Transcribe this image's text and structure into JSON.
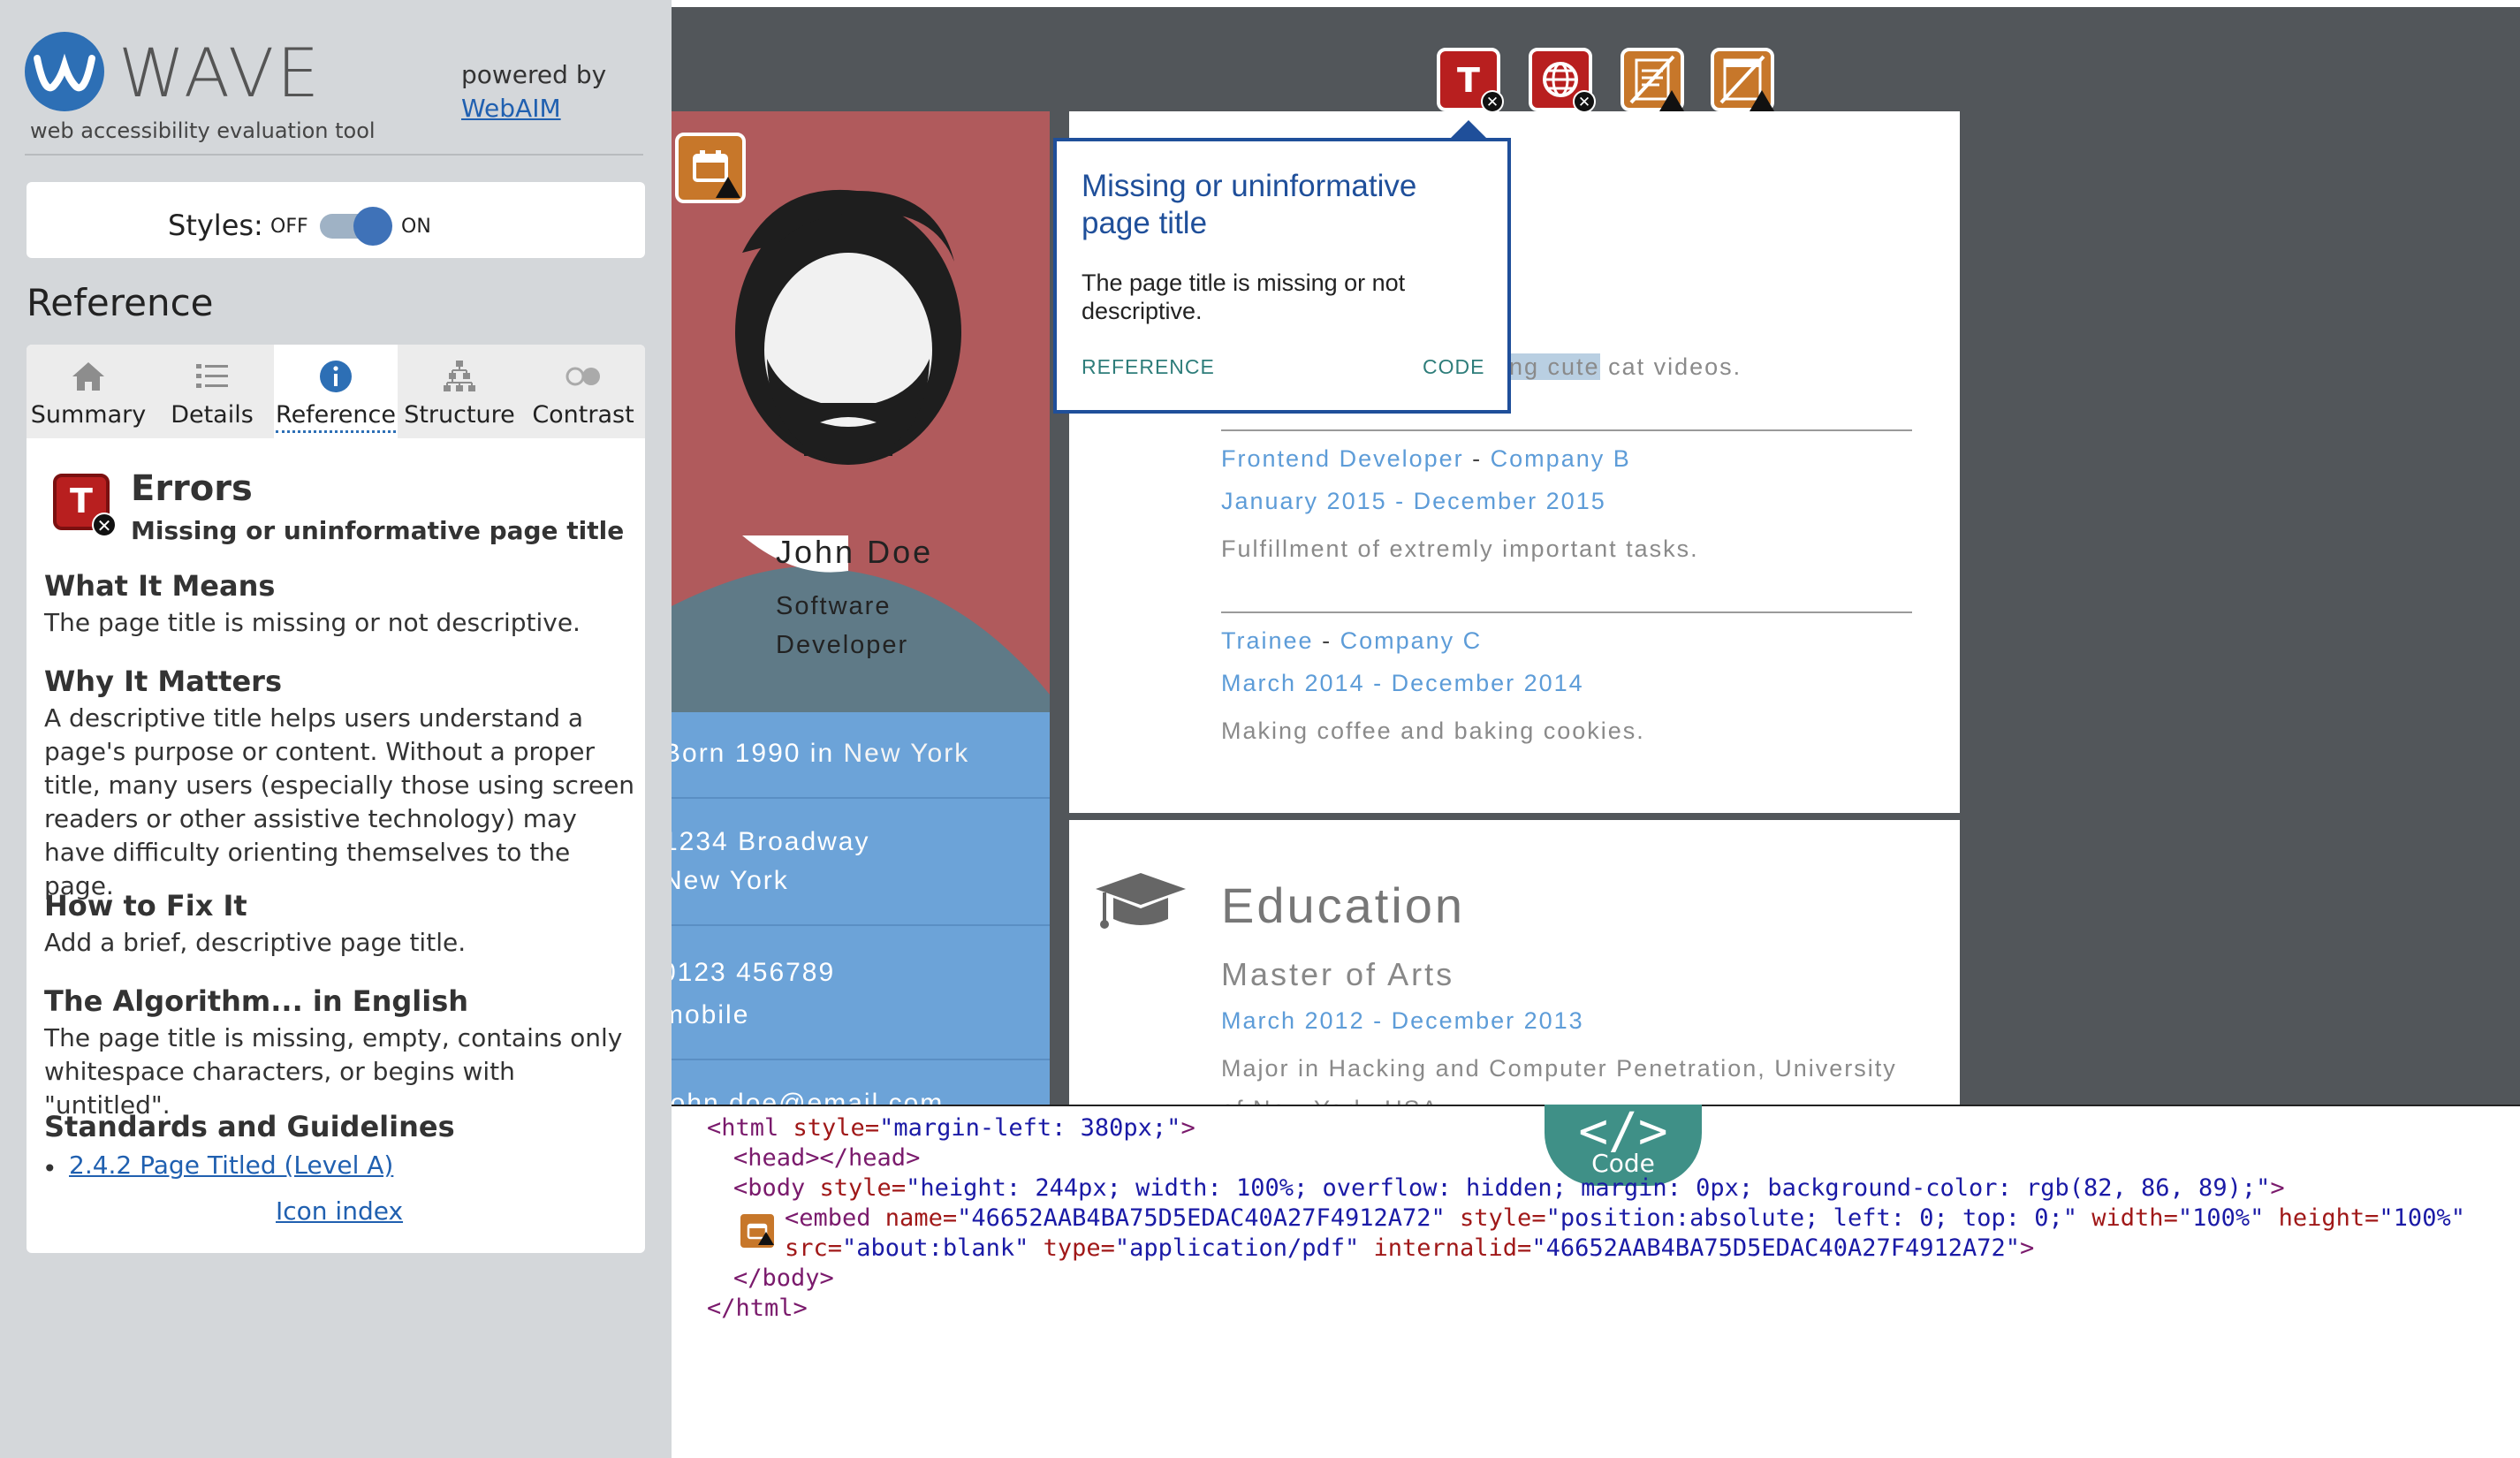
{
  "sidebar": {
    "logo_text": "WAVE",
    "logo_sub": "web accessibility evaluation tool",
    "powered_by": "powered by",
    "webaim_link": "WebAIM",
    "styles_label": "Styles:",
    "toggle_off": "OFF",
    "toggle_on": "ON",
    "reference_heading": "Reference",
    "tabs": [
      {
        "label": "Summary",
        "icon": "home-icon"
      },
      {
        "label": "Details",
        "icon": "list-icon"
      },
      {
        "label": "Reference",
        "icon": "info-icon"
      },
      {
        "label": "Structure",
        "icon": "structure-icon"
      },
      {
        "label": "Contrast",
        "icon": "contrast-icon"
      }
    ],
    "active_tab": "Reference",
    "error": {
      "category": "Errors",
      "name": "Missing or uninformative page title",
      "icon_letter": "T"
    },
    "sections": {
      "what_h": "What It Means",
      "what_p": "The page title is missing or not descriptive.",
      "why_h": "Why It Matters",
      "why_p": "A descriptive title helps users understand a page's purpose or content. Without a proper title, many users (especially those using screen readers or other assistive technology) may have difficulty orienting themselves to the page.",
      "fix_h": "How to Fix It",
      "fix_p": "Add a brief, descriptive page title.",
      "algo_h": "The Algorithm... in English",
      "algo_p": "The page title is missing, empty, contains only whitespace characters, or begins with \"untitled\".",
      "std_h": "Standards and Guidelines",
      "std_link": "2.4.2 Page Titled (Level A)",
      "icon_index": "Icon index"
    }
  },
  "preview": {
    "name": "John Doe",
    "role_line1": "Software",
    "role_line2": "Developer",
    "born_pre": "Born 1990 in",
    "born_city": "New York",
    "addr1": "1234 Broadway",
    "addr2": "New York",
    "phone": "0123 456789",
    "phone_type": "mobile",
    "email_partial": "john.doe@email.com",
    "job0_tail_hl": "ing cute",
    "job0_tail": "cat videos.",
    "job1_title": "Frontend Developer",
    "job1_company": "Company B",
    "job1_dates": "January 2015 - December 2015",
    "job1_desc": "Fulfillment of extremly important tasks.",
    "job2_title": "Trainee",
    "job2_company": "Company C",
    "job2_dates": "March 2014 - December 2014",
    "job2_desc": "Making coffee and baking cookies.",
    "edu_title": "Education",
    "edu_degree": "Master of Arts",
    "edu_dates": "March 2012 - December 2013",
    "edu_desc": "Major in Hacking and Computer Penetration, University",
    "edu_desc2": "of New York, USA",
    "dash": "-"
  },
  "tooltip": {
    "title": "Missing or uninformative page title",
    "body": "The page title is missing or not descriptive.",
    "reference": "REFERENCE",
    "code": "CODE"
  },
  "code_panel": {
    "tab_symbol": "</>",
    "tab_label": "Code",
    "l1_tag": "<html",
    "l1_attr": " style=",
    "l1_val": "\"margin-left: 380px;\"",
    "l1_end": ">",
    "l2": "<head></head>",
    "l3_tag": "<body",
    "l3_attr": " style=",
    "l3_val": "\"height: 244px; width: 100%; overflow: hidden; margin: 0px; background-color: rgb(82, 86, 89);\"",
    "l3_end": ">",
    "l4_tag": "<embed",
    "l4_a1": " name=",
    "l4_v1": "\"46652AAB4BA75D5EDAC40A27F4912A72\"",
    "l4_a2": " style=",
    "l4_v2": "\"position:absolute; left: 0; top: 0;\"",
    "l4_a3": " width=",
    "l4_v3": "\"100%\"",
    "l4_a4": " height=",
    "l4_v4": "\"100%\"",
    "l5_a1": "src=",
    "l5_v1": "\"about:blank\"",
    "l5_a2": " type=",
    "l5_v2": "\"application/pdf\"",
    "l5_a3": " internalid=",
    "l5_v3": "\"46652AAB4BA75D5EDAC40A27F4912A72\"",
    "l5_end": ">",
    "l6": "</body>",
    "l7": "</html>"
  },
  "colors": {
    "error_red": "#b81f1f",
    "alert_orange": "#c7772a",
    "wave_blue": "#2d6fb5",
    "link_blue": "#5d9cd8",
    "code_tab": "#3f9087"
  }
}
